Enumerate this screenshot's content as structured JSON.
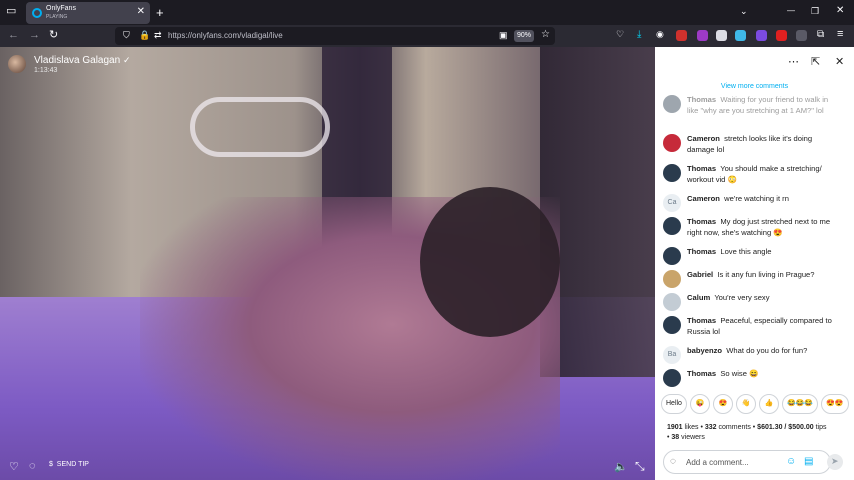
{
  "browser": {
    "tab": {
      "title": "OnlyFans",
      "subtitle": "PLAYING",
      "close": "✕"
    },
    "new_tab": "+",
    "window_controls": {
      "minimize": "—",
      "restore": "❐",
      "close": "✕"
    },
    "nav": {
      "back": "←",
      "forward": "→",
      "reload": "↻"
    },
    "url": "https://onlyfans.com/vladigal/live",
    "zoom": "90%"
  },
  "stream": {
    "creator_name": "Vladislava Galagan",
    "duration": "1:13:43",
    "send_tip_label": "SEND TIP"
  },
  "chat": {
    "view_more": "View more comments",
    "messages": [
      {
        "name": "Thomas",
        "text": "Waiting for your friend to walk in like \"why are you stretching at 1 AM?\" lol",
        "avatar": ""
      },
      {
        "name": "Cameron",
        "text": "stretch looks like it's doing damage lol",
        "avatar": ""
      },
      {
        "name": "Thomas",
        "text": "You should make a stretching/ workout vid 😳",
        "avatar": ""
      },
      {
        "name": "Cameron",
        "text": "we're watching it rn",
        "avatar": "Ca"
      },
      {
        "name": "Thomas",
        "text": "My dog just stretched next to me right now, she's watching 😍",
        "avatar": ""
      },
      {
        "name": "Thomas",
        "text": "Love this angle",
        "avatar": ""
      },
      {
        "name": "Gabriel",
        "text": "Is it any fun living in Prague?",
        "avatar": ""
      },
      {
        "name": "Calum",
        "text": "You're very sexy",
        "avatar": ""
      },
      {
        "name": "Thomas",
        "text": "Peaceful, especially compared to Russia lol",
        "avatar": ""
      },
      {
        "name": "babyenzo",
        "text": "What do you do for fun?",
        "avatar": "Ba"
      },
      {
        "name": "Thomas",
        "text": "So wise 😄",
        "avatar": ""
      }
    ],
    "reactions": [
      "Hello",
      "😜",
      "😍",
      "👋",
      "👍",
      "😂😂😂",
      "😍😍"
    ],
    "stats": {
      "likes": "1901",
      "likes_label": "likes",
      "comments": "332",
      "comments_label": "comments",
      "tips": "$601.30 / $500.00",
      "tips_label": "tips",
      "viewers": "38",
      "viewers_label": "viewers"
    },
    "comment_placeholder": "Add a comment..."
  },
  "colors": {
    "accent": "#00aff0",
    "chat_bg": "#ffffff",
    "browser_dark": "#1c1b22"
  }
}
